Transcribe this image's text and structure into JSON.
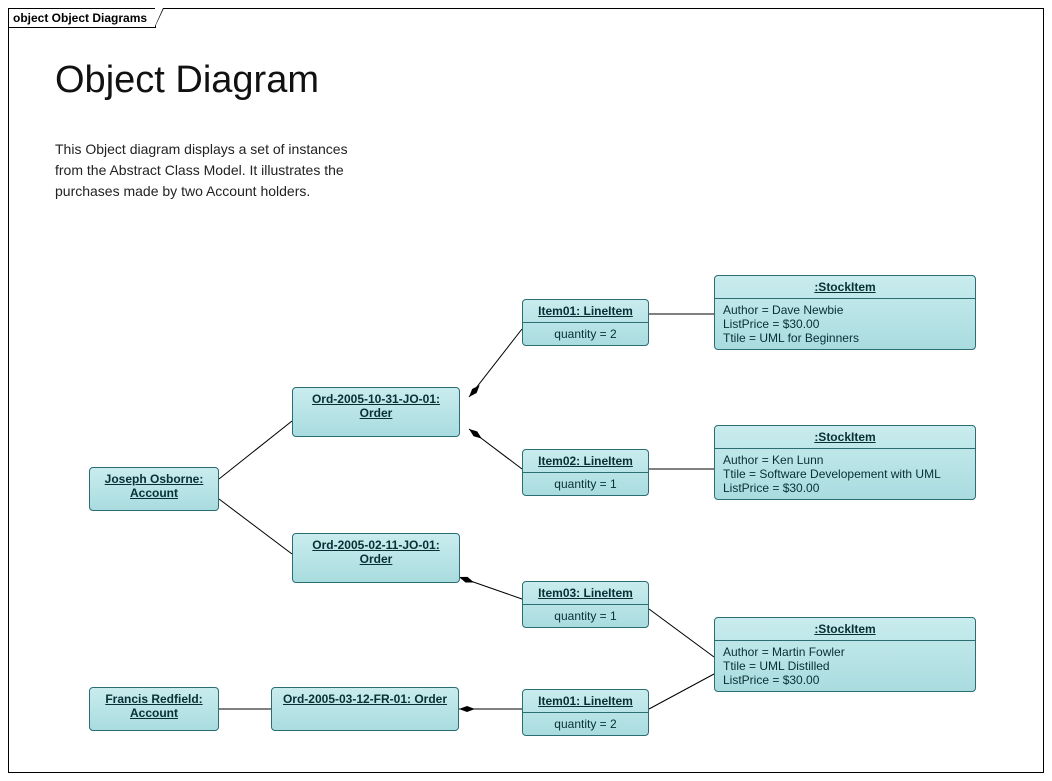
{
  "frame": {
    "tab": "object Object Diagrams"
  },
  "title": "Object Diagram",
  "description": "This Object diagram displays a set of instances from the Abstract Class Model. It illustrates the purchases made by two Account holders.",
  "nodes": {
    "acct1": {
      "header": "Joseph Osborne: Account"
    },
    "acct2": {
      "header": "Francis Redfield: Account"
    },
    "order1": {
      "header": "Ord-2005-10-31-JO-01: Order"
    },
    "order2": {
      "header": "Ord-2005-02-11-JO-01: Order"
    },
    "order3": {
      "header": "Ord-2005-03-12-FR-01: Order"
    },
    "item1": {
      "header": "Item01: LineItem",
      "body": "quantity = 2"
    },
    "item2": {
      "header": "Item02: LineItem",
      "body": "quantity = 1"
    },
    "item3": {
      "header": "Item03: LineItem",
      "body": "quantity = 1"
    },
    "item4": {
      "header": "Item01: LineItem",
      "body": "quantity = 2"
    },
    "stock1": {
      "header": ":StockItem",
      "line1": "Author = Dave Newbie",
      "line2": "ListPrice = $30.00",
      "line3": "Ttile = UML for Beginners"
    },
    "stock2": {
      "header": ":StockItem",
      "line1": "Author = Ken Lunn",
      "line2": "Ttile = Software Developement with UML",
      "line3": "ListPrice = $30.00"
    },
    "stock3": {
      "header": ":StockItem",
      "line1": "Author = Martin Fowler",
      "line2": "Ttile = UML Distilled",
      "line3": "ListPrice = $30.00"
    }
  }
}
